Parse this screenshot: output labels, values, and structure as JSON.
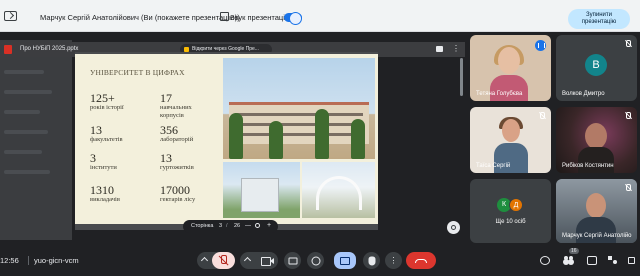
{
  "presenting_bar": {
    "presenting_text": "Марчук Сергій Анатолійович (Ви (покажете презентацію))",
    "audio_label": "Звук презентації",
    "audio_on": true,
    "stop_button": "Зупинити\nпрезентацію"
  },
  "viewer": {
    "file_name": "Про НУБіП 2025.pptx",
    "open_with": "Відкрити через Google Пре..."
  },
  "slide": {
    "title": "УНІВЕРСИТЕТ В ЦИФРАХ",
    "stats": [
      {
        "num": "125+",
        "label": "років історії"
      },
      {
        "num": "17",
        "label": "навчальних\nкорпусів"
      },
      {
        "num": "13",
        "label": "факультетів"
      },
      {
        "num": "356",
        "label": "лабораторій"
      },
      {
        "num": "3",
        "label": "інститути"
      },
      {
        "num": "13",
        "label": "гуртожитків"
      },
      {
        "num": "1310",
        "label": "викладачів"
      },
      {
        "num": "17000",
        "label": "гектарів лісу"
      }
    ]
  },
  "pager": {
    "label": "Сторінка",
    "current": "3",
    "separator": "/",
    "total": "26",
    "minus": "—",
    "plus": "+"
  },
  "participants": [
    {
      "name": "Тетяна Голубєва",
      "speaking": true
    },
    {
      "name": "Волков Дмитро",
      "avatar_letter": "В",
      "avatar_color": "#12848b",
      "muted": true
    },
    {
      "name": "Таїса Сергій",
      "muted": true
    },
    {
      "name": "Рибіков Костянтин",
      "muted": true
    },
    {
      "name": "Ще 10 осіб",
      "avatar_letters": [
        "К",
        "Д"
      ],
      "avatar_colors": [
        "#1e8e3e",
        "#e37400"
      ]
    },
    {
      "name": "Марчук Сергій Анатолійо",
      "muted": true
    }
  ],
  "bottom_bar": {
    "time": "12:56",
    "meeting_code": "yuo-gicn-vcm",
    "participant_count": "16"
  },
  "icons": {
    "screen_share": "present-screen-icon",
    "mic": "mic-off-icon",
    "camera": "camera-icon",
    "captions": "captions-icon",
    "emoji": "emoji-icon",
    "present": "present-icon",
    "hand": "raise-hand-icon",
    "more": "more-vert-icon",
    "leave": "call-end-icon"
  },
  "colors": {
    "accent": "#1a73e8",
    "leave": "#dc362e",
    "present_active": "#a8c7fa"
  }
}
